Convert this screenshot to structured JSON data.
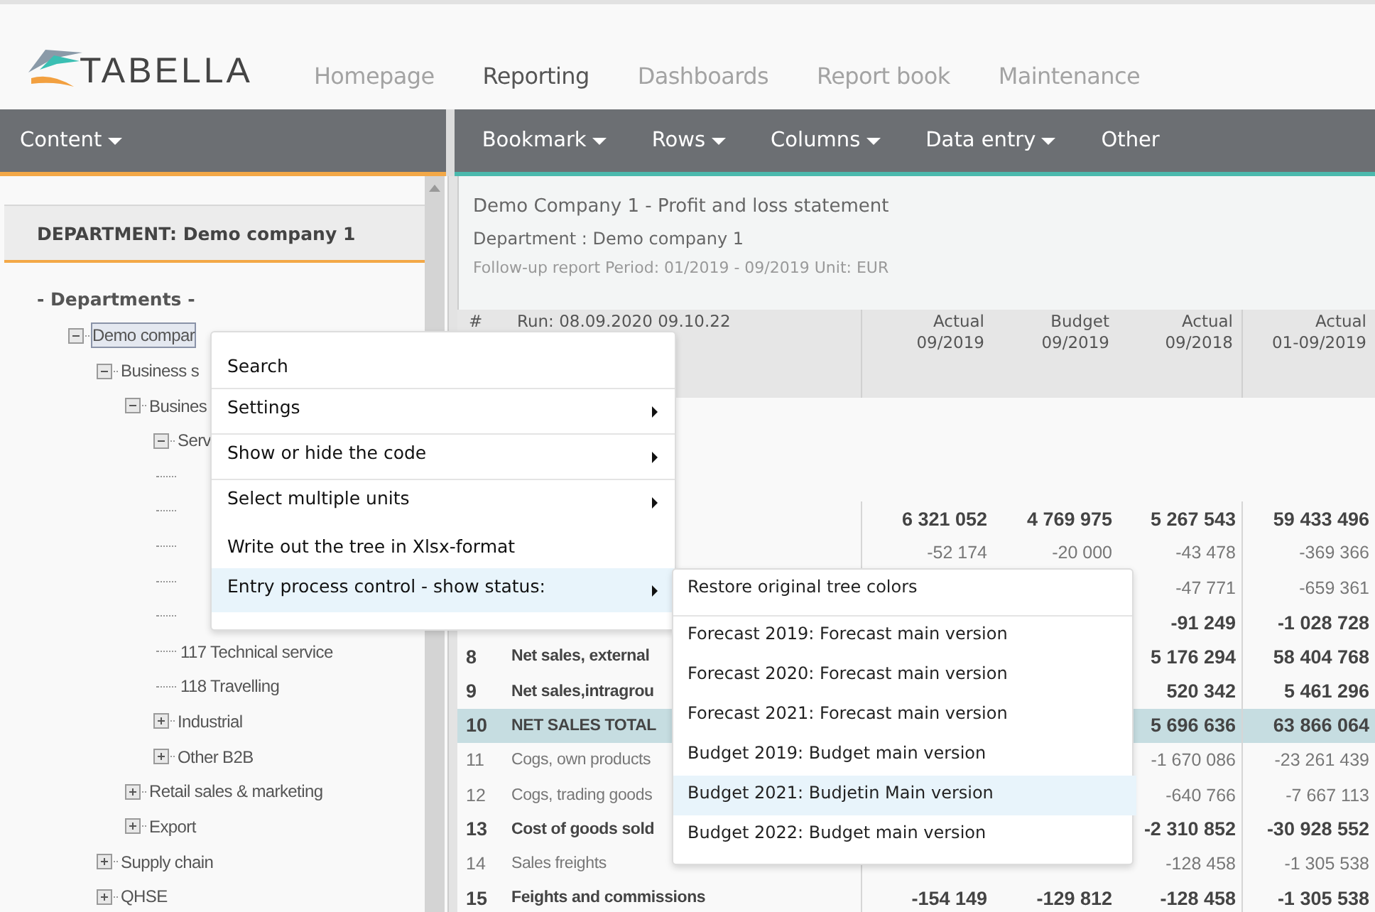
{
  "header": {
    "logo_text": "TABELLA",
    "nav": [
      {
        "label": "Homepage",
        "selected": false
      },
      {
        "label": "Reporting",
        "selected": true
      },
      {
        "label": "Dashboards",
        "selected": false
      },
      {
        "label": "Report book",
        "selected": false
      },
      {
        "label": "Maintenance",
        "selected": false
      }
    ]
  },
  "left_toolbar": {
    "items": [
      {
        "label": "Content",
        "dropdown": true
      }
    ]
  },
  "right_toolbar": {
    "items": [
      {
        "label": "Bookmark",
        "dropdown": true
      },
      {
        "label": "Rows",
        "dropdown": true
      },
      {
        "label": "Columns",
        "dropdown": true
      },
      {
        "label": "Data entry",
        "dropdown": true
      },
      {
        "label": "Other",
        "dropdown": false
      }
    ]
  },
  "sidebar": {
    "title": "DEPARTMENT: Demo company 1",
    "tree_title": "- Departments -",
    "tree": [
      {
        "kind": "folder",
        "label": "Demo compar",
        "expanded": true,
        "selected": true,
        "children": [
          {
            "kind": "folder",
            "label": "Business s",
            "expanded": true,
            "selected": false,
            "children": [
              {
                "kind": "folder",
                "label": "Busines",
                "expanded": true,
                "selected": false,
                "children": [
                  {
                    "kind": "folder",
                    "label": "Serv",
                    "expanded": true,
                    "selected": false,
                    "children": [
                      {
                        "kind": "leaf"
                      },
                      {
                        "kind": "leaf"
                      },
                      {
                        "kind": "leaf"
                      },
                      {
                        "kind": "leaf"
                      },
                      {
                        "kind": "leaf"
                      },
                      {
                        "kind": "leaf",
                        "label": "117 Technical service"
                      },
                      {
                        "kind": "leaf",
                        "label": "118 Travelling"
                      }
                    ]
                  },
                  {
                    "kind": "folder",
                    "label": "Industrial",
                    "expanded": false,
                    "selected": false
                  },
                  {
                    "kind": "folder",
                    "label": "Other B2B",
                    "expanded": false,
                    "selected": false
                  }
                ]
              },
              {
                "kind": "folder",
                "label": "Retail sales & marketing",
                "expanded": false,
                "selected": false
              },
              {
                "kind": "folder",
                "label": "Export",
                "expanded": false,
                "selected": false
              }
            ]
          },
          {
            "kind": "folder",
            "label": "Supply chain",
            "expanded": false,
            "selected": false
          },
          {
            "kind": "folder",
            "label": "QHSE",
            "expanded": false,
            "selected": false
          }
        ]
      }
    ]
  },
  "report": {
    "title": "Demo Company 1 - Profit and loss statement",
    "subtitle": "Department : Demo company 1",
    "info": "Follow-up report Period: 01/2019 - 09/2019 Unit: EUR",
    "table": {
      "number_column": "#",
      "run_label": "Run: 08.09.2020 09.10.22",
      "columns": [
        {
          "label": "Actual",
          "period": "09/2019"
        },
        {
          "label": "Budget",
          "period": "09/2019"
        },
        {
          "label": "Actual",
          "period": "09/2018"
        },
        {
          "label": "Actual",
          "period": "01-09/2019"
        }
      ],
      "rows": [
        {
          "bold": true,
          "highlighted": false,
          "values": {
            "column_1": "6 321 052",
            "column_2": "4 769 975",
            "column_3": "5 267 543",
            "column_4": "59 433 496"
          }
        },
        {
          "bold": false,
          "highlighted": false,
          "values": {
            "column_1": "-52 174",
            "column_2": "-20 000",
            "column_3": "-43 478",
            "column_4": "-369 366"
          }
        },
        {
          "bold": false,
          "highlighted": false,
          "values": {
            "column_3": "-47 771",
            "column_4": "-659 361"
          }
        },
        {
          "bold": true,
          "highlighted": false,
          "values": {
            "column_3": "-91 249",
            "column_4": "-1 028 728"
          }
        },
        {
          "num": "8",
          "label": "Net sales, external",
          "bold": true,
          "highlighted": false,
          "values": {
            "column_3": "5 176 294",
            "column_4": "58 404 768"
          }
        },
        {
          "num": "9",
          "label": "Net sales,intragrou",
          "bold": true,
          "highlighted": false,
          "values": {
            "column_3": "520 342",
            "column_4": "5 461 296"
          }
        },
        {
          "num": "10",
          "label": "NET SALES TOTAL",
          "bold": true,
          "highlighted": true,
          "values": {
            "column_3": "5 696 636",
            "column_4": "63 866 064"
          }
        },
        {
          "num": "11",
          "label": "Cogs, own products",
          "bold": false,
          "highlighted": false,
          "values": {
            "column_3": "-1 670 086",
            "column_4": "-23 261 439"
          }
        },
        {
          "num": "12",
          "label": "Cogs, trading goods",
          "bold": false,
          "highlighted": false,
          "values": {
            "column_3": "-640 766",
            "column_4": "-7 667 113"
          }
        },
        {
          "num": "13",
          "label": "Cost of goods sold",
          "bold": true,
          "highlighted": false,
          "values": {
            "column_3": "-2 310 852",
            "column_4": "-30 928 552"
          }
        },
        {
          "num": "14",
          "label": "Sales freights",
          "bold": false,
          "highlighted": false,
          "values": {
            "column_3": "-128 458",
            "column_4": "-1 305 538"
          }
        },
        {
          "num": "15",
          "label": "Feights and commissions",
          "bold": true,
          "highlighted": false,
          "values": {
            "column_1": "-154 149",
            "column_2": "-129 812",
            "column_3": "-128 458",
            "column_4": "-1 305 538"
          }
        }
      ]
    }
  },
  "context_menu": {
    "items": [
      {
        "label": "Search",
        "submenu": false,
        "selected": false,
        "divider": true
      },
      {
        "label": "Settings",
        "submenu": true,
        "selected": false,
        "divider": true
      },
      {
        "label": "Show or hide the code",
        "submenu": true,
        "selected": false,
        "divider": true
      },
      {
        "label": "Select multiple units",
        "submenu": true,
        "selected": false,
        "divider": false
      },
      {
        "label": "Write out the tree in Xlsx-format",
        "submenu": false,
        "selected": false,
        "divider": false
      },
      {
        "label": "Entry process control - show status:",
        "submenu": true,
        "selected": true,
        "divider": false
      }
    ]
  },
  "submenu": {
    "items": [
      {
        "label": "Restore original tree colors",
        "selected": false,
        "divider": true
      },
      {
        "label": "Forecast 2019: Forecast main version",
        "selected": false,
        "divider": false
      },
      {
        "label": "Forecast 2020: Forecast main version",
        "selected": false,
        "divider": false
      },
      {
        "label": "Forecast 2021: Forecast main version",
        "selected": false,
        "divider": false
      },
      {
        "label": "Budget 2019: Budget main version",
        "selected": false,
        "divider": false
      },
      {
        "label": "Budget 2021: Budjetin Main version",
        "selected": true,
        "divider": false
      },
      {
        "label": "Budget 2022: Budget main version",
        "selected": false,
        "divider": false
      }
    ]
  }
}
